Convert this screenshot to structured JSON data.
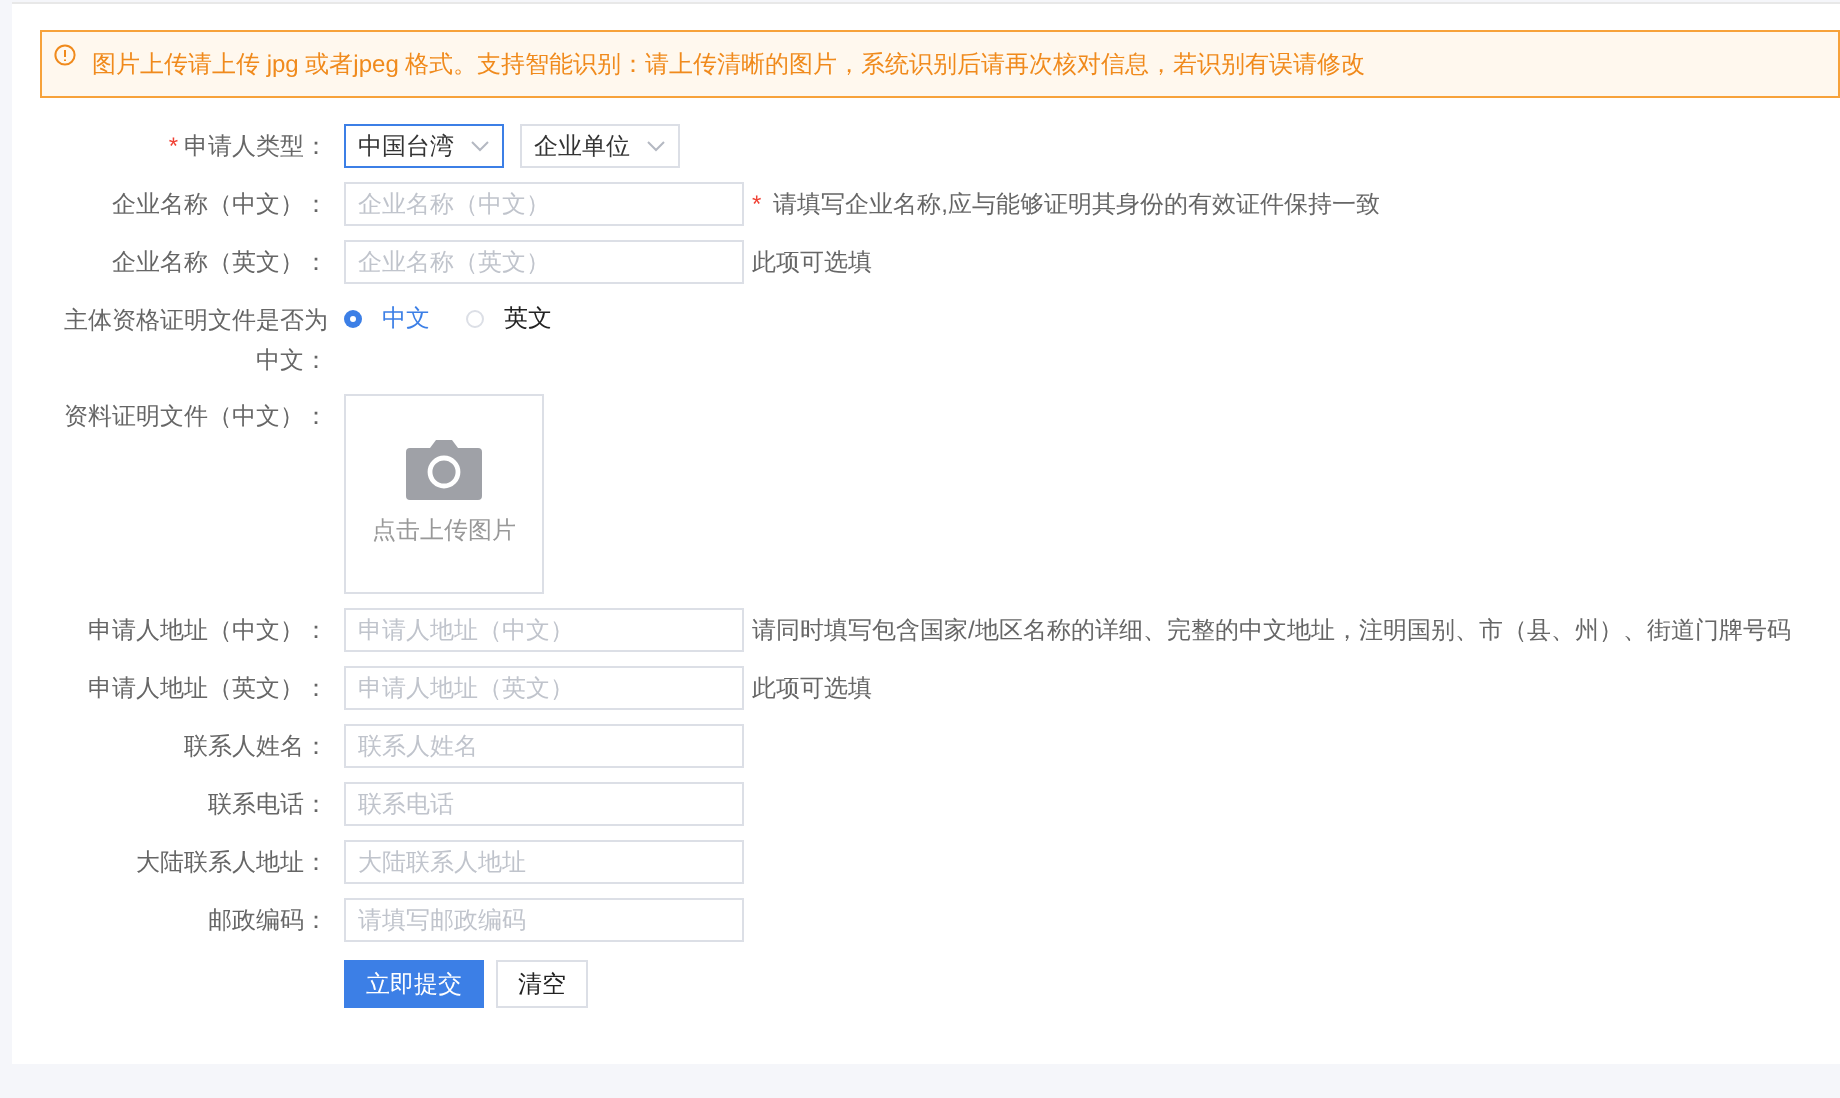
{
  "notice": {
    "text": "图片上传请上传 jpg 或者jpeg 格式。支持智能识别：请上传清晰的图片，系统识别后请再次核对信息，若识别有误请修改"
  },
  "rows": [
    {
      "kind": "selects",
      "mark": "*",
      "label": "申请人类型：",
      "selects": [
        {
          "value": "中国台湾",
          "focused": true
        },
        {
          "value": "企业单位",
          "focused": false
        }
      ]
    },
    {
      "kind": "input",
      "label": "企业名称（中文）：",
      "placeholder": "企业名称（中文）",
      "hint_mark": "*",
      "hint": "请填写企业名称,应与能够证明其身份的有效证件保持一致"
    },
    {
      "kind": "input",
      "label": "企业名称（英文）：",
      "placeholder": "企业名称（英文）",
      "hint": "此项可选填"
    },
    {
      "kind": "radio",
      "label": "主体资格证明文件是否为中文：",
      "options": [
        {
          "label": "中文",
          "selected": true
        },
        {
          "label": "英文",
          "selected": false
        }
      ]
    },
    {
      "kind": "upload",
      "label": "资料证明文件（中文）：",
      "text": "点击上传图片"
    },
    {
      "kind": "input",
      "label": "申请人地址（中文）：",
      "placeholder": "申请人地址（中文）",
      "hint": "请同时填写包含国家/地区名称的详细、完整的中文地址，注明国别、市（县、州）、街道门牌号码"
    },
    {
      "kind": "input",
      "label": "申请人地址（英文）：",
      "placeholder": "申请人地址（英文）",
      "hint": "此项可选填"
    },
    {
      "kind": "input",
      "label": "联系人姓名：",
      "placeholder": "联系人姓名"
    },
    {
      "kind": "input",
      "label": "联系电话：",
      "placeholder": "联系电话"
    },
    {
      "kind": "input",
      "label": "大陆联系人地址：",
      "placeholder": "大陆联系人地址"
    },
    {
      "kind": "input",
      "label": "邮政编码：",
      "placeholder": "请填写邮政编码"
    },
    {
      "kind": "buttons",
      "buttons": [
        {
          "label": "立即提交",
          "kind": "primary"
        },
        {
          "label": "清空",
          "kind": "default"
        }
      ]
    }
  ]
}
